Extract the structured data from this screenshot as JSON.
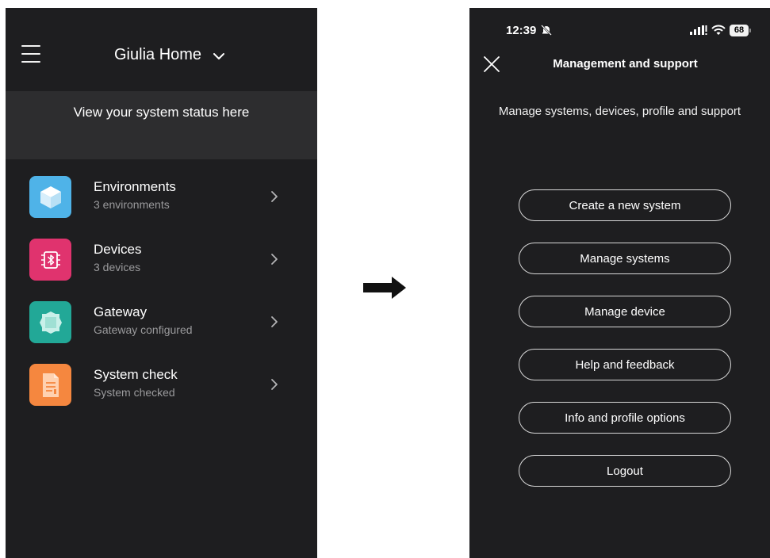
{
  "left_screen": {
    "home_name": "Giulia Home",
    "status_banner": "View your system status here",
    "menu": [
      {
        "title": "Environments",
        "subtitle": "3 environments",
        "icon": "cube-icon",
        "color": "#4fb3e8"
      },
      {
        "title": "Devices",
        "subtitle": "3 devices",
        "icon": "bluetooth-chip-icon",
        "color": "#e0336e"
      },
      {
        "title": "Gateway",
        "subtitle": "Gateway configured",
        "icon": "gateway-chip-icon",
        "color": "#22a897"
      },
      {
        "title": "System check",
        "subtitle": "System checked",
        "icon": "document-check-icon",
        "color": "#f5873f"
      }
    ]
  },
  "right_screen": {
    "status_bar": {
      "time": "12:39",
      "battery": "68"
    },
    "header_title": "Management and support",
    "subtitle": "Manage systems, devices, profile and support",
    "actions": [
      "Create a new system",
      "Manage systems",
      "Manage device",
      "Help and feedback",
      "Info and profile options",
      "Logout"
    ]
  },
  "colors": {
    "background_dark": "#1e1e20",
    "banner": "#2d2d2f",
    "secondary_text": "#9a9a9c"
  }
}
